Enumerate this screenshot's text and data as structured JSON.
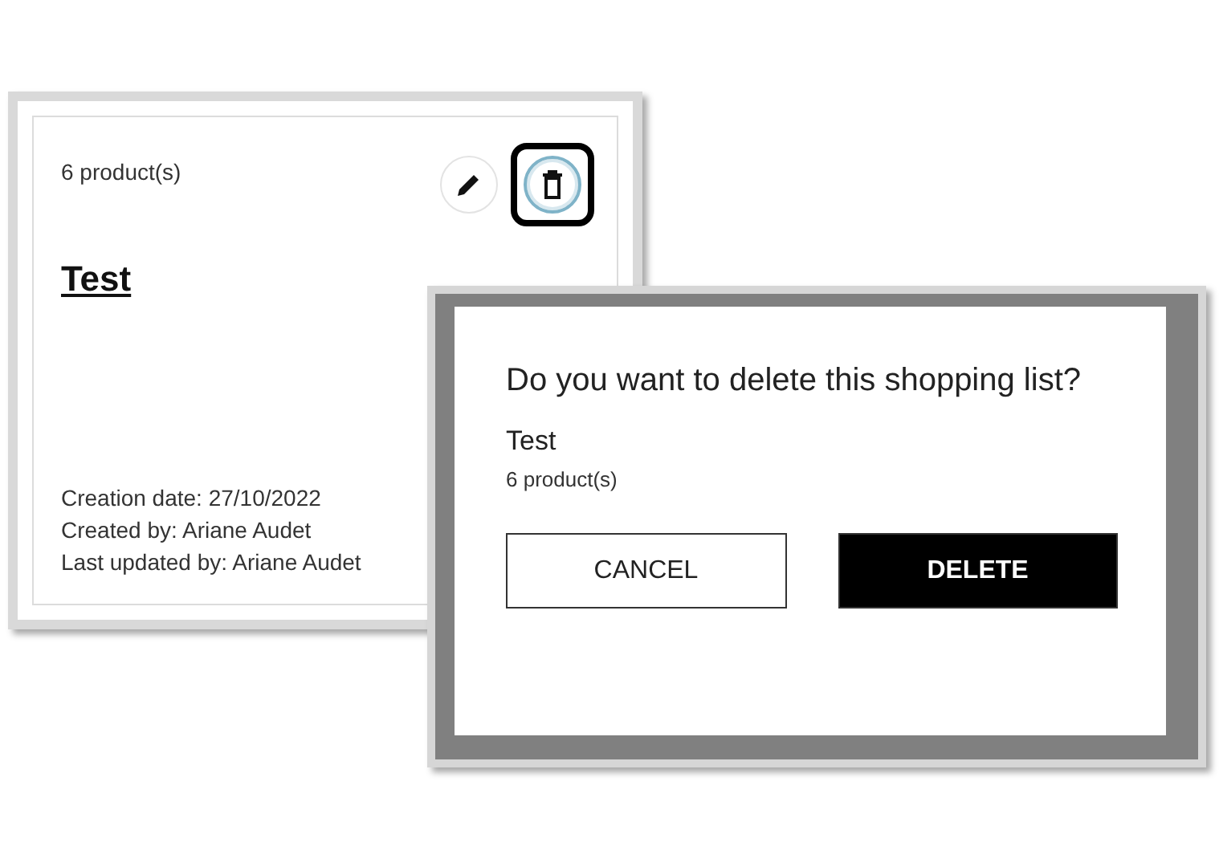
{
  "card": {
    "product_count": "6 product(s)",
    "title": "Test",
    "meta": [
      "Creation date: 27/10/2022",
      "Created by: Ariane Audet",
      "Last updated by: Ariane Audet"
    ],
    "actions": [
      {
        "kind": "edit",
        "highlighted": false
      },
      {
        "kind": "delete",
        "highlighted": true
      }
    ]
  },
  "dialog": {
    "question": "Do you want to delete this shopping list?",
    "list_name": "Test",
    "product_count": "6 product(s)",
    "buttons": [
      {
        "label": "CANCEL",
        "kind": "secondary"
      },
      {
        "label": "DELETE",
        "kind": "primary"
      }
    ]
  }
}
